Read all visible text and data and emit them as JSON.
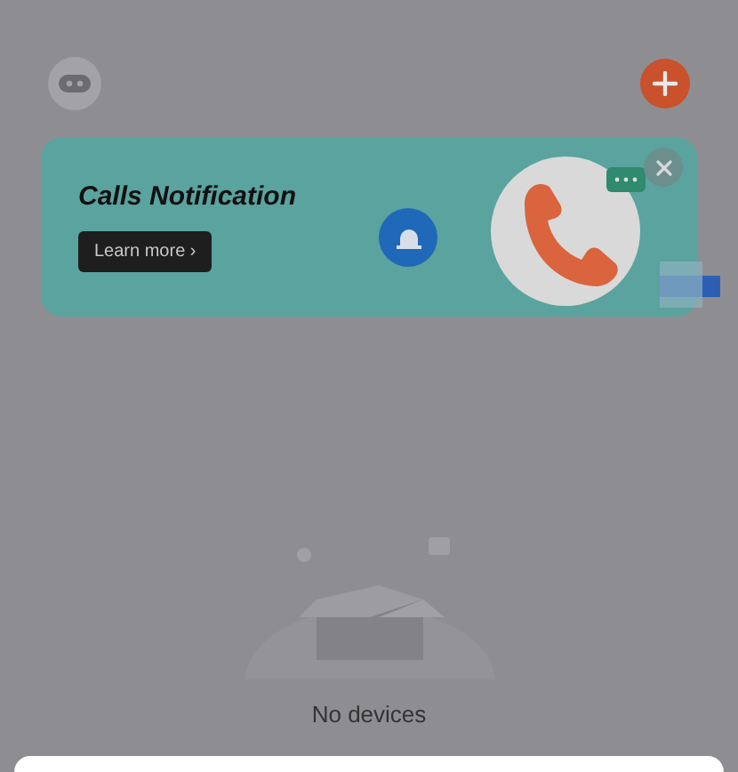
{
  "banner": {
    "title": "Calls Notification",
    "button": "Learn more ›"
  },
  "empty_state": {
    "text": "No devices"
  }
}
